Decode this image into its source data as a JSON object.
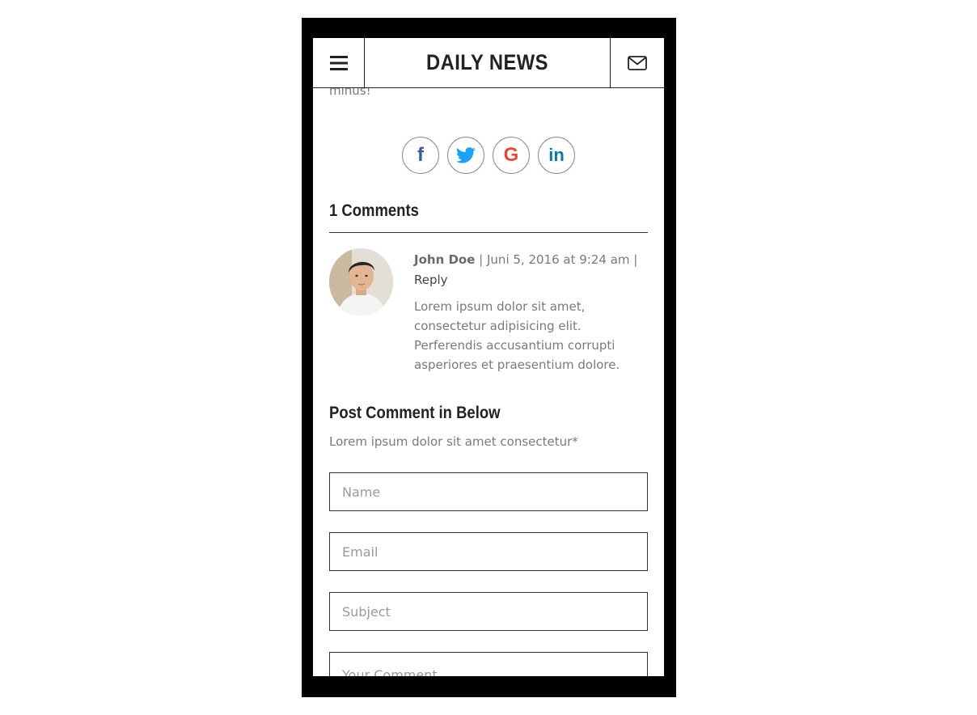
{
  "header": {
    "title": "DAILY NEWS",
    "menu_icon": "hamburger-menu-icon",
    "mail_icon": "envelope-icon"
  },
  "article": {
    "cut_text": "minus!"
  },
  "share": {
    "items": [
      {
        "network": "facebook",
        "glyph": "f",
        "color": "#3b5998"
      },
      {
        "network": "twitter",
        "icon": "twitter-bird-icon",
        "color": "#1da1f2"
      },
      {
        "network": "google",
        "glyph": "G",
        "color": "#dd4b39"
      },
      {
        "network": "linkedin",
        "glyph": "in",
        "color": "#0e76a8"
      }
    ]
  },
  "comments": {
    "title": "1 Comments",
    "items": [
      {
        "author": "John Doe",
        "separator": " | ",
        "date": "Juni 5, 2016 at 9:24 am",
        "separator_end": " |",
        "reply_label": "Reply",
        "body": "Lorem ipsum dolor sit amet, consectetur adipisicing elit. Perferendis accusantium corrupti asperiores et praesentium dolore."
      }
    ]
  },
  "post_comment": {
    "title": "Post Comment in Below",
    "subtitle": "Lorem ipsum dolor sit amet consectetur*",
    "fields": {
      "name_placeholder": "Name",
      "email_placeholder": "Email",
      "subject_placeholder": "Subject",
      "comment_placeholder": "Your Comment"
    }
  }
}
